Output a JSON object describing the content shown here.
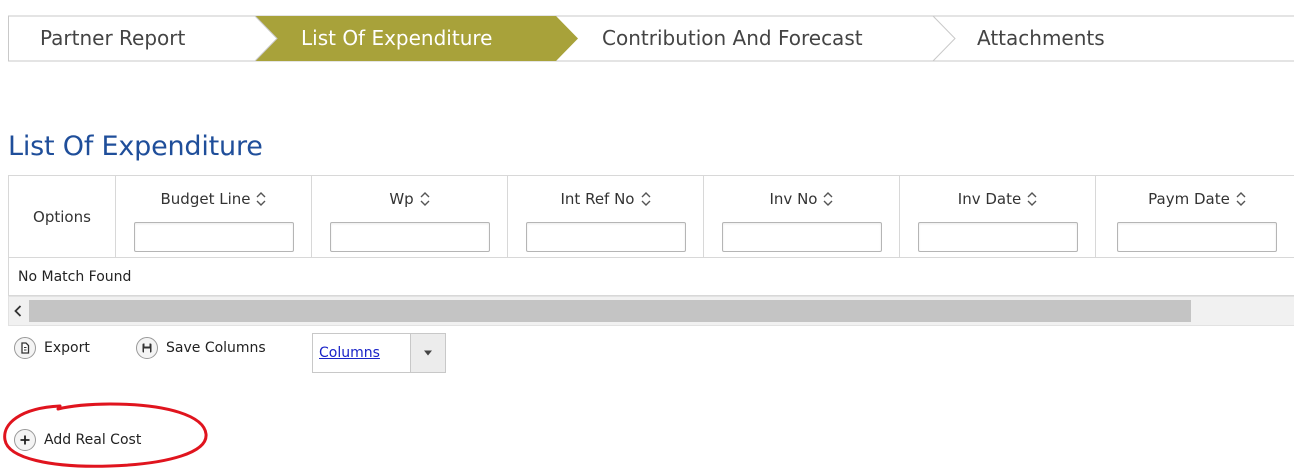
{
  "wizard": {
    "steps": [
      {
        "label": "Partner Report",
        "active": false
      },
      {
        "label": "List Of Expenditure",
        "active": true
      },
      {
        "label": "Contribution And Forecast",
        "active": false
      },
      {
        "label": "Attachments",
        "active": false
      }
    ],
    "active_color": "#a8a23a"
  },
  "section": {
    "title": "List Of Expenditure"
  },
  "table": {
    "options_header": "Options",
    "columns": [
      {
        "label": "Budget Line",
        "filter_value": ""
      },
      {
        "label": "Wp",
        "filter_value": ""
      },
      {
        "label": "Int Ref No",
        "filter_value": ""
      },
      {
        "label": "Inv No",
        "filter_value": ""
      },
      {
        "label": "Inv Date",
        "filter_value": ""
      },
      {
        "label": "Paym Date",
        "filter_value": ""
      }
    ],
    "empty_message": "No Match Found"
  },
  "toolbar": {
    "export_label": "Export",
    "save_columns_label": "Save Columns",
    "columns_label": "Columns"
  },
  "actions": {
    "add_real_cost_label": "Add Real Cost"
  },
  "icons": {
    "export": "export-icon",
    "save": "save-icon",
    "add": "plus-circle-icon",
    "sort": "sort-icon",
    "dropdown": "caret-down-icon",
    "scroll_left": "chevron-left-icon"
  },
  "annotation": {
    "ring_color": "#e0141e"
  }
}
